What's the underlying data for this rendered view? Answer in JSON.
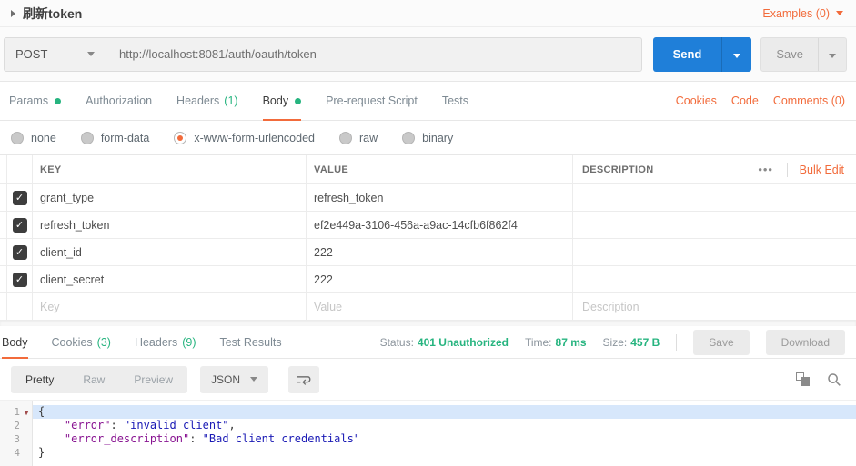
{
  "colors": {
    "accent_orange": "#F26B3B",
    "green": "#26B47F",
    "send_blue": "#1F7FD9",
    "checkbox_dark": "#3d3d3d",
    "json_key": "#881391",
    "json_string": "#1a1ab5",
    "selection_blue": "#d7e7fb"
  },
  "header": {
    "title": "刷新token",
    "examples": "Examples (0)"
  },
  "request": {
    "method": "POST",
    "url": "http://localhost:8081/auth/oauth/token",
    "send": "Send",
    "save": "Save"
  },
  "request_tabs": [
    {
      "label": "Params",
      "dot": true
    },
    {
      "label": "Authorization"
    },
    {
      "label": "Headers",
      "count": "(1)"
    },
    {
      "label": "Body",
      "dot": true,
      "active": true
    },
    {
      "label": "Pre-request Script"
    },
    {
      "label": "Tests"
    }
  ],
  "quick_links": {
    "cookies": "Cookies",
    "code": "Code",
    "comments": "Comments (0)"
  },
  "body_modes": [
    {
      "label": "none",
      "selected": false
    },
    {
      "label": "form-data",
      "selected": false
    },
    {
      "label": "x-www-form-urlencoded",
      "selected": true
    },
    {
      "label": "raw",
      "selected": false
    },
    {
      "label": "binary",
      "selected": false
    }
  ],
  "kv_table": {
    "headers": {
      "key": "KEY",
      "value": "VALUE",
      "description": "DESCRIPTION"
    },
    "more": "•••",
    "bulk_edit": "Bulk Edit",
    "rows": [
      {
        "key": "grant_type",
        "value": "refresh_token",
        "checked": true
      },
      {
        "key": "refresh_token",
        "value": "ef2e449a-3106-456a-a9ac-14cfb6f862f4",
        "checked": true
      },
      {
        "key": "client_id",
        "value": "222",
        "checked": true
      },
      {
        "key": "client_secret",
        "value": "222",
        "checked": true
      }
    ],
    "placeholder": {
      "key": "Key",
      "value": "Value",
      "description": "Description"
    }
  },
  "response": {
    "tabs": [
      {
        "label": "Body",
        "active": true
      },
      {
        "label": "Cookies",
        "count": "(3)"
      },
      {
        "label": "Headers",
        "count": "(9)"
      },
      {
        "label": "Test Results"
      }
    ],
    "status": {
      "label": "Status:",
      "value": "401 Unauthorized"
    },
    "time": {
      "label": "Time:",
      "value": "87 ms"
    },
    "size": {
      "label": "Size:",
      "value": "457 B"
    },
    "save": "Save",
    "download": "Download"
  },
  "viewer": {
    "modes": [
      {
        "label": "Pretty",
        "active": true
      },
      {
        "label": "Raw"
      },
      {
        "label": "Preview"
      }
    ],
    "language": "JSON",
    "code_lines": [
      {
        "num": "1",
        "fold": true,
        "selected": true,
        "tokens": [
          {
            "t": "punc",
            "s": "{"
          }
        ]
      },
      {
        "num": "2",
        "tokens": [
          {
            "t": "punc",
            "s": "    "
          },
          {
            "t": "key",
            "s": "\"error\""
          },
          {
            "t": "punc",
            "s": ": "
          },
          {
            "t": "str",
            "s": "\"invalid_client\""
          },
          {
            "t": "punc",
            "s": ","
          }
        ]
      },
      {
        "num": "3",
        "tokens": [
          {
            "t": "punc",
            "s": "    "
          },
          {
            "t": "key",
            "s": "\"error_description\""
          },
          {
            "t": "punc",
            "s": ": "
          },
          {
            "t": "str",
            "s": "\"Bad client credentials\""
          }
        ]
      },
      {
        "num": "4",
        "tokens": [
          {
            "t": "punc",
            "s": "}"
          }
        ]
      }
    ]
  }
}
